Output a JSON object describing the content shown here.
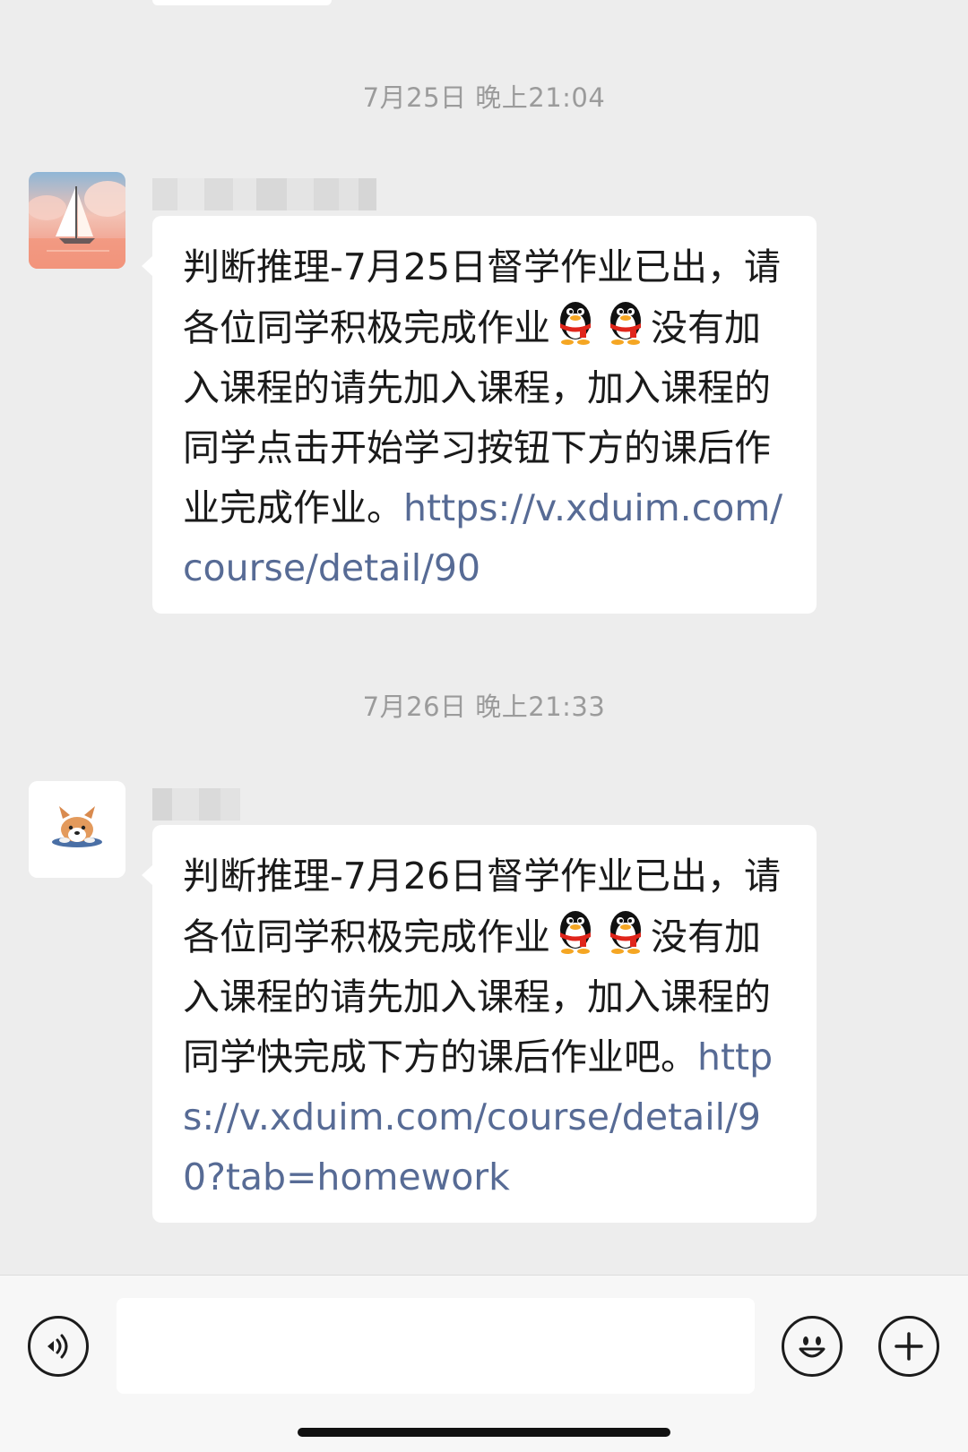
{
  "messages": [
    {
      "timestamp": "7月25日 晚上21:04",
      "avatar": "sailboat-sunset-avatar",
      "sender_name": "",
      "text_parts": [
        "判断推理-7月25日督学作业已出，请各位同学积极完成作业",
        "没有加入课程的请先加入课程，加入课程的同学点击开始学习按钮下方的课后作业完成作业。"
      ],
      "emoji": "qq-penguin-emoji",
      "link": "https://v.xduim.com/course/detail/90"
    },
    {
      "timestamp": "7月26日 晚上21:33",
      "avatar": "corgi-dog-avatar",
      "sender_name": "",
      "text_parts": [
        "判断推理-7月26日督学作业已出，请各位同学积极完成作业",
        "没有加入课程的请先加入课程，加入课程的同学快完成下方的课后作业吧。"
      ],
      "emoji": "qq-penguin-emoji",
      "link": "https://v.xduim.com/course/detail/90?tab=homework"
    }
  ],
  "input_bar": {
    "voice_icon": "voice-icon",
    "emoji_icon": "smiley-icon",
    "more_icon": "plus-icon",
    "input_value": ""
  },
  "colors": {
    "background": "#ededed",
    "bubble": "#ffffff",
    "link": "#576b95",
    "timestamp": "#9b9b9b"
  }
}
